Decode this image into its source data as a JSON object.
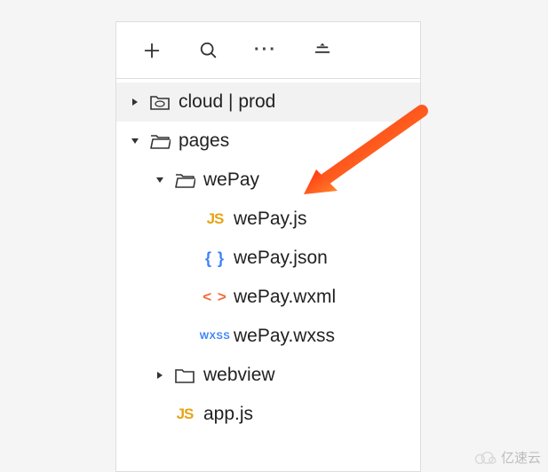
{
  "watermark": "亿速云",
  "tree": {
    "root0": {
      "label": "cloud | prod"
    },
    "root1": {
      "label": "pages"
    },
    "child_wepay": {
      "label": "wePay"
    },
    "file_wepay_js": {
      "label": "wePay.js",
      "badge": "JS"
    },
    "file_wepay_json": {
      "label": "wePay.json",
      "badge": "{ }"
    },
    "file_wepay_wxml": {
      "label": "wePay.wxml",
      "badge": "< >"
    },
    "file_wepay_wxss": {
      "label": "wePay.wxss",
      "badge": "WXSS"
    },
    "child_webview": {
      "label": "webview"
    },
    "file_app_js": {
      "label": "app.js",
      "badge": "JS"
    }
  }
}
